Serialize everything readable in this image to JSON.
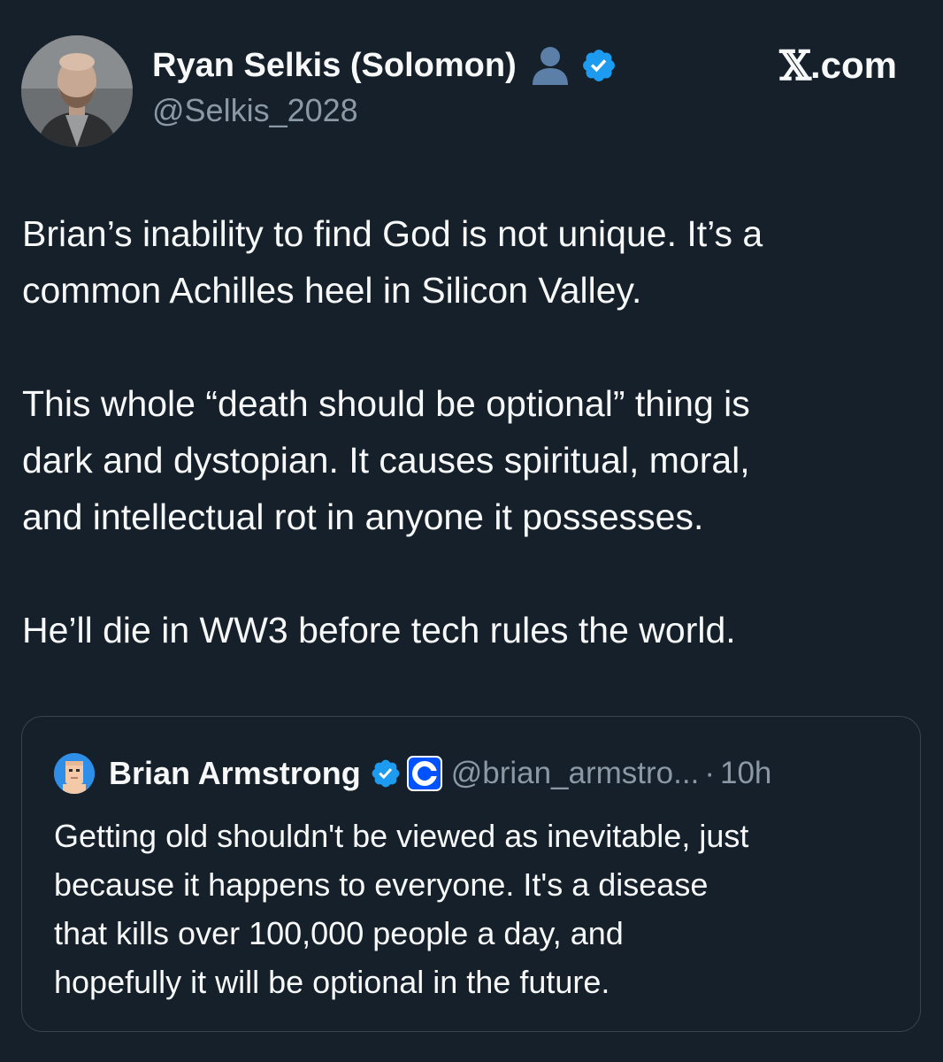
{
  "author": {
    "display_name": "Ryan Selkis (Solomon)",
    "handle": "@Selkis_2028"
  },
  "brand": {
    "x_glyph": "𝕏",
    "domain": ".com"
  },
  "tweet": {
    "paragraphs": [
      [
        "Brian’s inability to find God is not unique. It’s a",
        "common Achilles heel in Silicon Valley."
      ],
      [
        "This whole “death should be optional” thing is",
        "dark and dystopian. It causes spiritual, moral,",
        "and intellectual rot in anyone it possesses."
      ],
      [
        "He’ll die in WW3 before tech rules the world."
      ]
    ]
  },
  "quote": {
    "display_name": "Brian Armstrong",
    "handle": "@brian_armstro...",
    "separator": "·",
    "time": "10h",
    "lines": [
      "Getting old shouldn't be viewed as inevitable, just",
      "because it happens to everyone. It's a disease",
      "that kills over 100,000 people a day, and",
      "hopefully it will be optional in the future."
    ]
  },
  "colors": {
    "background": "#15202b",
    "text": "#f7f9f9",
    "muted": "#8b98a5",
    "verified_blue": "#1d9bf0",
    "coinbase_blue": "#0052ff",
    "border": "#38444d"
  },
  "icons": {
    "profile_emoji": "bust-in-silhouette-icon",
    "verified": "verified-badge-icon",
    "affiliate": "coinbase-logo-icon"
  }
}
